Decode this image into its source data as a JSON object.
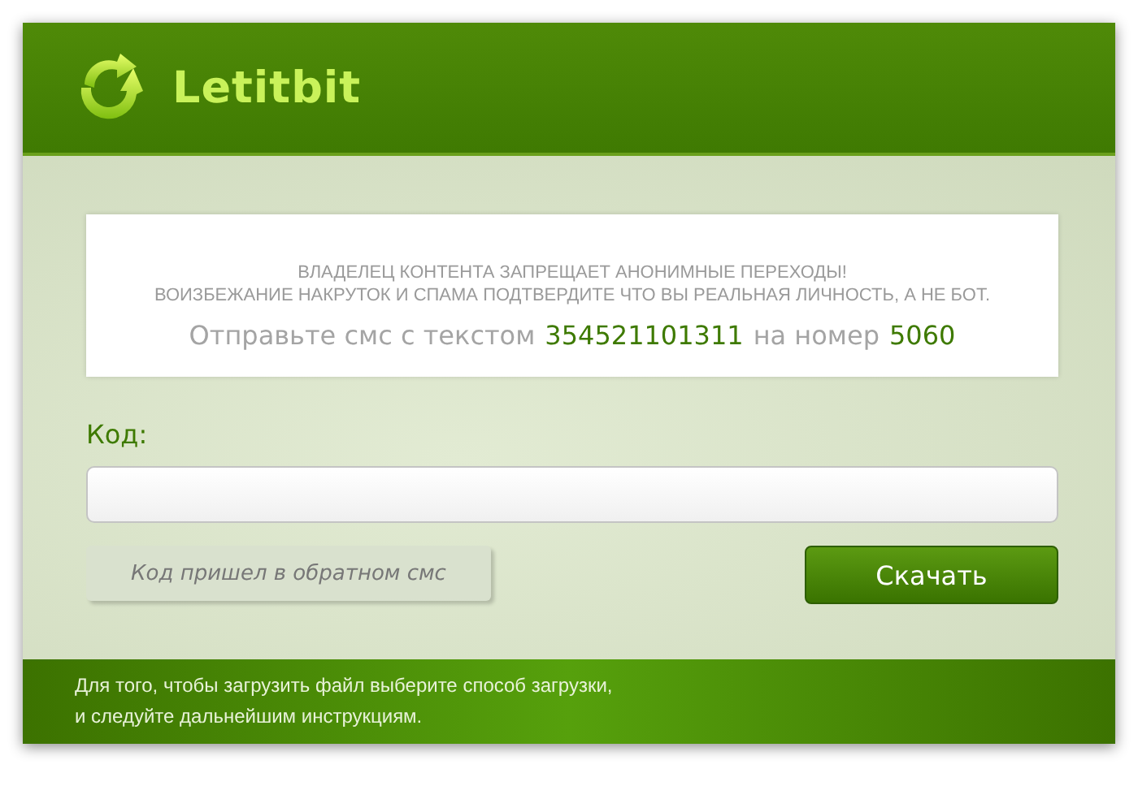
{
  "header": {
    "logo_text": "Letitbit"
  },
  "notice": {
    "lines": [
      "ВЛАДЕЛЕЦ КОНТЕНТА ЗАПРЕЩАЕТ АНОНИМНЫЕ ПЕРЕХОДЫ!",
      "ВОИЗБЕЖАНИЕ НАКРУТОК И СПАМА ПОДТВЕРДИТЕ ЧТО ВЫ РЕАЛЬНАЯ ЛИЧНОСТЬ, А НЕ БОТ."
    ],
    "sms": [
      {
        "kind": "text",
        "text": "Отправьте смс с текстом"
      },
      {
        "kind": "value",
        "text": "354521101311"
      },
      {
        "kind": "text",
        "text": "на номер"
      },
      {
        "kind": "value",
        "text": "5060"
      }
    ]
  },
  "code_label": "Код:",
  "secondary_button": "Код пришел в обратном смс",
  "download_button": "Скачать",
  "footer": {
    "lines": [
      "Для того, чтобы загрузить файл выберите способ загрузки,",
      "и следуйте дальнейшим инструкциям."
    ]
  }
}
